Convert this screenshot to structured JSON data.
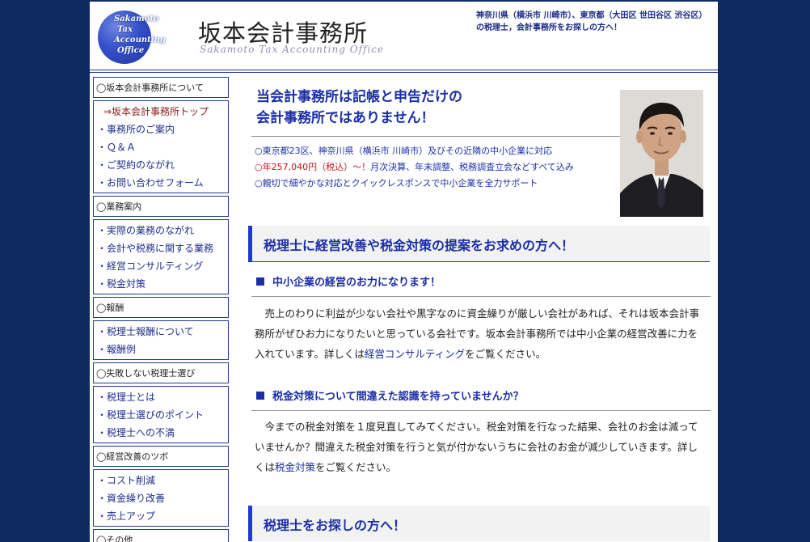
{
  "header": {
    "logo_lines": [
      "Sakamoto",
      "Tax",
      "Accounting",
      "Office"
    ],
    "title": "坂本会計事務所",
    "subtitle": "Sakamoto Tax Accounting Office",
    "note": "神奈川県（横浜市 川崎市）、東京都（大田区 世田谷区 渋谷区）の税理士，会計事務所をお探しの方へ！"
  },
  "sidebar": {
    "sections": [
      {
        "title": "◯坂本会計事務所について",
        "items": [
          "⇒坂本会計事務所トップ",
          "・事務所のご案内",
          "・Ｑ＆Ａ",
          "・ご契約のながれ",
          "・お問い合わせフォーム"
        ]
      },
      {
        "title": "◯業務案内",
        "items": [
          "・実際の業務のながれ",
          "・会計や税務に関する業務",
          "・経営コンサルティング",
          "・税金対策"
        ]
      },
      {
        "title": "◯報酬",
        "items": [
          "・税理士報酬について",
          "・報酬例"
        ]
      },
      {
        "title": "◯失敗しない税理士選び",
        "items": [
          "・税理士とは",
          "・税理士選びのポイント",
          "・税理士への不満"
        ]
      },
      {
        "title": "◯経営改善のツボ",
        "items": [
          "・コスト削減",
          "・資金繰り改善",
          "・売上アップ"
        ]
      },
      {
        "title": "◯その他",
        "items": []
      }
    ]
  },
  "intro": {
    "heading_line1": "当会計事務所は記帳と申告だけの",
    "heading_line2": "会計事務所ではありません！",
    "bullet1": "○東京都23区、神奈川県（横浜市 川崎市）及びその近隣の中小企業に対応",
    "bullet2_red": "○年257,040円（税込）～！",
    "bullet2_rest": "月次決算、年末調整、税務調査立会などすべて込み",
    "bullet3": "○親切で細やかな対応とクイックレスポンスで中小企業を全力サポート"
  },
  "section1": {
    "heading": "税理士に経営改善や税金対策の提案をお求めの方へ！",
    "sub1": "中小企業の経営のお力になります！",
    "para1_before": "売上のわりに利益が少ない会社や黒字なのに資金繰りが厳しい会社があれば、それは坂本会計事務所がぜひお力になりたいと思っている会社です。坂本会計事務所では中小企業の経営改善に力を入れています。詳しくは",
    "para1_link": "経営コンサルティング",
    "para1_after": "をご覧ください。",
    "sub2": "税金対策について間違えた認識を持っていませんか？",
    "para2_before": "今までの税金対策を１度見直してみてください。税金対策を行なった結果、会社のお金は減っていませんか？間違えた税金対策を行うと気が付かないうちに会社のお金が減少していきます。詳しくは",
    "para2_link": "税金対策",
    "para2_after": "をご覧ください。"
  },
  "section2": {
    "heading": "税理士をお探しの方へ！"
  },
  "colors": {
    "background": "#0f2a5e",
    "accent": "#1a2ea8",
    "highlight_red": "#c0141b"
  }
}
